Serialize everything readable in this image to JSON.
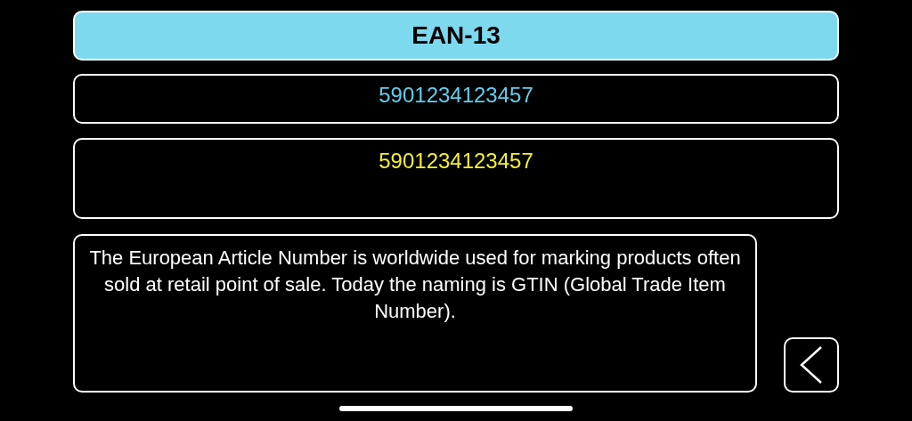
{
  "header": {
    "title": "EAN-13"
  },
  "code_field": {
    "value": "5901234123457"
  },
  "result_field": {
    "value": "5901234123457"
  },
  "description": "The European Article Number is worldwide used for marking products often sold at retail point of sale. Today the naming is GTIN (Global Trade Item Number)."
}
